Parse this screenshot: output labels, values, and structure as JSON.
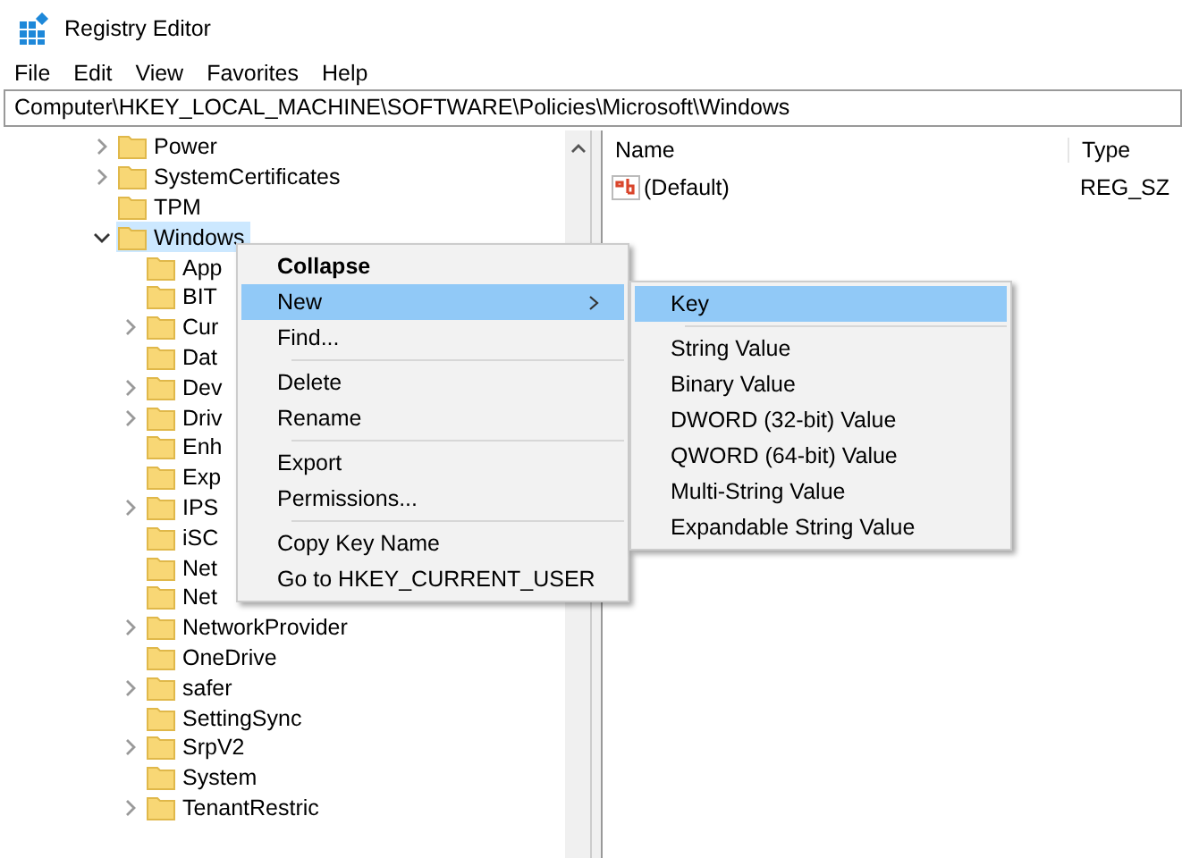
{
  "window": {
    "title": "Registry Editor"
  },
  "menu_bar": [
    "File",
    "Edit",
    "View",
    "Favorites",
    "Help"
  ],
  "address": "Computer\\HKEY_LOCAL_MACHINE\\SOFTWARE\\Policies\\Microsoft\\Windows",
  "tree": [
    {
      "label": "Power",
      "expander": true,
      "expanded": false,
      "selected": false
    },
    {
      "label": "SystemCertificates",
      "expander": true,
      "expanded": false,
      "selected": false
    },
    {
      "label": "TPM",
      "expander": false,
      "selected": false
    },
    {
      "label": "Windows",
      "expander": true,
      "expanded": true,
      "selected": true,
      "children": [
        {
          "label": "App",
          "expander": false,
          "selected": false
        },
        {
          "label": "BIT",
          "expander": false,
          "selected": false
        },
        {
          "label": "Cur",
          "expander": true,
          "expanded": false,
          "selected": false
        },
        {
          "label": "Dat",
          "expander": false,
          "selected": false
        },
        {
          "label": "Dev",
          "expander": true,
          "expanded": false,
          "selected": false
        },
        {
          "label": "Driv",
          "expander": true,
          "expanded": false,
          "selected": false
        },
        {
          "label": "Enh",
          "expander": false,
          "selected": false
        },
        {
          "label": "Exp",
          "expander": false,
          "selected": false
        },
        {
          "label": "IPS",
          "expander": true,
          "expanded": false,
          "selected": false
        },
        {
          "label": "iSC",
          "expander": false,
          "selected": false
        },
        {
          "label": "Net",
          "expander": false,
          "selected": false
        },
        {
          "label": "Net",
          "expander": false,
          "selected": false
        },
        {
          "label": "NetworkProvider",
          "expander": true,
          "expanded": false,
          "selected": false
        },
        {
          "label": "OneDrive",
          "expander": false,
          "selected": false
        },
        {
          "label": "safer",
          "expander": true,
          "expanded": false,
          "selected": false
        },
        {
          "label": "SettingSync",
          "expander": false,
          "selected": false
        },
        {
          "label": "SrpV2",
          "expander": true,
          "expanded": false,
          "selected": false
        },
        {
          "label": "System",
          "expander": false,
          "selected": false
        },
        {
          "label": "TenantRestric",
          "expander": true,
          "expanded": false,
          "selected": false
        }
      ]
    }
  ],
  "values": {
    "columns": [
      "Name",
      "Type"
    ],
    "rows": [
      {
        "name": "(Default)",
        "type": "REG_SZ"
      }
    ]
  },
  "context_menu": [
    {
      "kind": "item",
      "label": "Collapse",
      "default": true,
      "selected": false,
      "submenu": false
    },
    {
      "kind": "item",
      "label": "New",
      "default": false,
      "selected": true,
      "submenu": true
    },
    {
      "kind": "item",
      "label": "Find...",
      "default": false,
      "selected": false,
      "submenu": false
    },
    {
      "kind": "separator"
    },
    {
      "kind": "item",
      "label": "Delete",
      "default": false,
      "selected": false,
      "submenu": false
    },
    {
      "kind": "item",
      "label": "Rename",
      "default": false,
      "selected": false,
      "submenu": false
    },
    {
      "kind": "separator"
    },
    {
      "kind": "item",
      "label": "Export",
      "default": false,
      "selected": false,
      "submenu": false
    },
    {
      "kind": "item",
      "label": "Permissions...",
      "default": false,
      "selected": false,
      "submenu": false
    },
    {
      "kind": "separator"
    },
    {
      "kind": "item",
      "label": "Copy Key Name",
      "default": false,
      "selected": false,
      "submenu": false
    },
    {
      "kind": "item",
      "label": "Go to HKEY_CURRENT_USER",
      "default": false,
      "selected": false,
      "submenu": false
    }
  ],
  "submenu": [
    {
      "kind": "item",
      "label": "Key",
      "selected": true
    },
    {
      "kind": "separator"
    },
    {
      "kind": "item",
      "label": "String Value",
      "selected": false
    },
    {
      "kind": "item",
      "label": "Binary Value",
      "selected": false
    },
    {
      "kind": "item",
      "label": "DWORD (32-bit) Value",
      "selected": false
    },
    {
      "kind": "item",
      "label": "QWORD (64-bit) Value",
      "selected": false
    },
    {
      "kind": "item",
      "label": "Multi-String Value",
      "selected": false
    },
    {
      "kind": "item",
      "label": "Expandable String Value",
      "selected": false
    }
  ]
}
